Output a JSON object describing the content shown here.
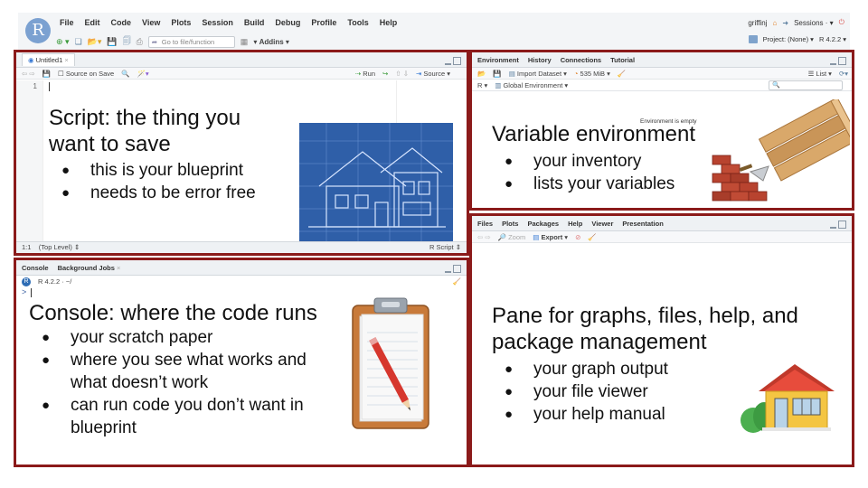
{
  "menubar": {
    "logo": "R",
    "items": [
      "File",
      "Edit",
      "Code",
      "View",
      "Plots",
      "Session",
      "Build",
      "Debug",
      "Profile",
      "Tools",
      "Help"
    ],
    "goto_placeholder": "Go to file/function",
    "addins": "Addins",
    "user": "griffinj",
    "sessions": "Sessions",
    "project": "Project: (None)",
    "r_version": "R 4.2.2"
  },
  "script_pane": {
    "tab": "Untitled1",
    "source_on_save": "Source on Save",
    "run": "Run",
    "source": "Source",
    "line_number": "1",
    "status_position": "1:1",
    "status_scope": "(Top Level)",
    "status_type": "R Script",
    "heading_line1": "Script: the thing you",
    "heading_line2": "want to save",
    "bullets": [
      "this is your blueprint",
      "needs to be error free"
    ]
  },
  "console_pane": {
    "tabs": [
      "Console",
      "Background Jobs"
    ],
    "version_line": "R 4.2.2 · ~/",
    "prompt": ">",
    "heading": "Console: where the code runs",
    "bullets": [
      "your scratch paper",
      "where you see what works and what doesn’t work",
      "can run code you don’t want in blueprint"
    ]
  },
  "env_pane": {
    "tabs": [
      "Environment",
      "History",
      "Connections",
      "Tutorial"
    ],
    "import_dataset": "Import Dataset",
    "memory": "535 MiB",
    "list": "List",
    "r_dropdown": "R",
    "global_env": "Global Environment",
    "empty_msg": "Environment is empty",
    "heading": "Variable environment",
    "bullets": [
      "your inventory",
      "lists your variables"
    ]
  },
  "files_pane": {
    "tabs": [
      "Files",
      "Plots",
      "Packages",
      "Help",
      "Viewer",
      "Presentation"
    ],
    "zoom": "Zoom",
    "export": "Export",
    "heading_line1": "Pane for graphs, files, help, and",
    "heading_line2": "package management",
    "bullets": [
      "your graph output",
      "your file viewer",
      "your help manual"
    ]
  },
  "colors": {
    "pane_border": "#8b1a1a",
    "blueprint": "#2f5fa8",
    "clipboard": "#c87a3a",
    "house_wall": "#f4c542",
    "house_roof": "#c0392b"
  }
}
